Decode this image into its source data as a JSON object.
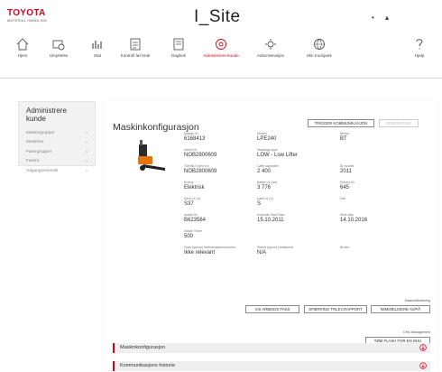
{
  "header": {
    "logo": "TOYOTA",
    "logo_sub": "MATERIAL HANDLING",
    "app_title": "I_Site",
    "icon_1": "•",
    "icon_2": "▴"
  },
  "nav": {
    "items": [
      {
        "label": "Hjem",
        "icon": "home-icon"
      },
      {
        "label": "Utnyttelse",
        "icon": "utilization-icon"
      },
      {
        "label": "Stat",
        "icon": "stat-icon"
      },
      {
        "label": "Kontroll før bruk",
        "icon": "checklist-icon"
      },
      {
        "label": "Dagbok",
        "icon": "logbook-icon"
      },
      {
        "label": "Administrere kunde",
        "icon": "admin-icon",
        "active": true
      },
      {
        "label": "Administrasjon",
        "icon": "settings-icon"
      },
      {
        "label": "Min truckpark",
        "icon": "globe-icon"
      },
      {
        "label": "Hjelp",
        "icon": "help-icon"
      }
    ]
  },
  "sidebar": {
    "title": "Administrere kunde",
    "items": [
      {
        "label": "Maskingrupper"
      },
      {
        "label": "Maskiner"
      },
      {
        "label": "Førergrupper"
      },
      {
        "label": "Førere"
      },
      {
        "label": "Adgangsoversikt"
      }
    ]
  },
  "main": {
    "title": "Maskinkonfigurasjon",
    "buttons": {
      "trigger": "TRIGGER KOMMUNIKASJON",
      "disabled": "GENERATING"
    },
    "fields": [
      {
        "key": "Maskin ID",
        "value": "6168413"
      },
      {
        "key": "Modell",
        "value": "LPE240"
      },
      {
        "key": "Merke",
        "value": "BT"
      },
      {
        "key": "Intern Nr",
        "value": "NOB2800609"
      },
      {
        "key": "Maskingruppe",
        "value": "LOW - Low Lifter"
      },
      {
        "key": "",
        "value": ""
      },
      {
        "key": "TMHNO Intern nr.",
        "value": "NOB2800609"
      },
      {
        "key": "Løfte kapasitet",
        "value": "2 400"
      },
      {
        "key": "År modell",
        "value": "2011"
      },
      {
        "key": "Energi",
        "value": "Elektrisk"
      },
      {
        "key": "Batteri Id (Ah)",
        "value": "3 776"
      },
      {
        "key": "Enhets ID",
        "value": "645"
      },
      {
        "key": "Serie Id (V)",
        "value": "S37"
      },
      {
        "key": "Løfte Id (V)",
        "value": "S"
      },
      {
        "key": "Dør",
        "value": ""
      },
      {
        "key": "Avtale Nr.",
        "value": "B623564"
      },
      {
        "key": "Kontrakt Start Dato",
        "value": "15.10.2011"
      },
      {
        "key": "Slutt dato",
        "value": "14.10.2016"
      },
      {
        "key": "Avtale Timer",
        "value": "500"
      },
      {
        "key": "Data (Ignore) Maksimalsbeskrivelse",
        "value": "Ikke relevant"
      },
      {
        "key": "Status (Ignore) Maksimal",
        "value": "N/A"
      },
      {
        "key": "Broker",
        "value": ""
      }
    ],
    "section1_label": "Maskinhåndtering",
    "action_buttons": [
      "VIS ARBEIDS PASS",
      "SPØRRING TRLEV.RAPPORT",
      "IMMOBILISERE AV/PÅ"
    ],
    "section2_label": "DHU Management",
    "dhu_button": "TØM FLASH FOR EN DHU",
    "accordions": [
      {
        "label": "Maskinkonfigurasjon"
      },
      {
        "label": "Kommunikasjons historie"
      }
    ]
  },
  "colors": {
    "brand": "#d0021b",
    "sidebar_bg": "#f2f2f2"
  }
}
